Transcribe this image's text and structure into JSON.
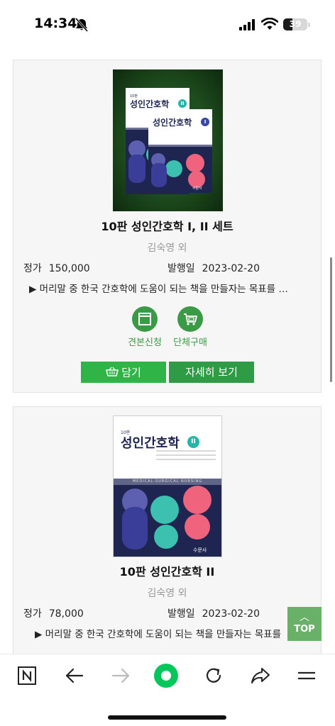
{
  "status_bar": {
    "time": "14:34",
    "battery": "39",
    "battery_level": 0.39
  },
  "books": [
    {
      "title": "10판 성인간호학 I, II 세트",
      "author": "김숙영 외",
      "price_label": "정가",
      "price": "150,000",
      "date_label": "발행일",
      "date": "2023-02-20",
      "description": "▶ 머리말 중 한국 간호학에 도움이 되는 책을 만들자는 목표를 …",
      "actions": [
        {
          "label": "견본신청",
          "icon": "book-icon"
        },
        {
          "label": "단체구매",
          "icon": "cart-icon"
        }
      ],
      "cart_button": "담기",
      "detail_button": "자세히 보기",
      "cover": {
        "small_label": "10판",
        "title_back": "성인간호학",
        "badge_back": "II",
        "title_front": "성인간호학",
        "badge_front": "I",
        "publisher": "수문사"
      }
    },
    {
      "title": "10판 성인간호학 II",
      "author": "김숙영 외",
      "price_label": "정가",
      "price": "78,000",
      "date_label": "발행일",
      "date": "2023-02-20",
      "description": "▶ 머리말 중 한국 간호학에 도움이 되는 책을 만들자는 목표를",
      "cover": {
        "small_label": "10판",
        "title": "성인간호학",
        "badge": "II",
        "band_text": "MEDICAL-SURGICAL NURSING",
        "publisher": "수문사"
      }
    }
  ],
  "top_button": "TOP",
  "colors": {
    "accent_green": "#3b9a45",
    "button_green": "#2fb547",
    "naver_green": "#03c75a",
    "cover_navy": "#1d2550"
  }
}
